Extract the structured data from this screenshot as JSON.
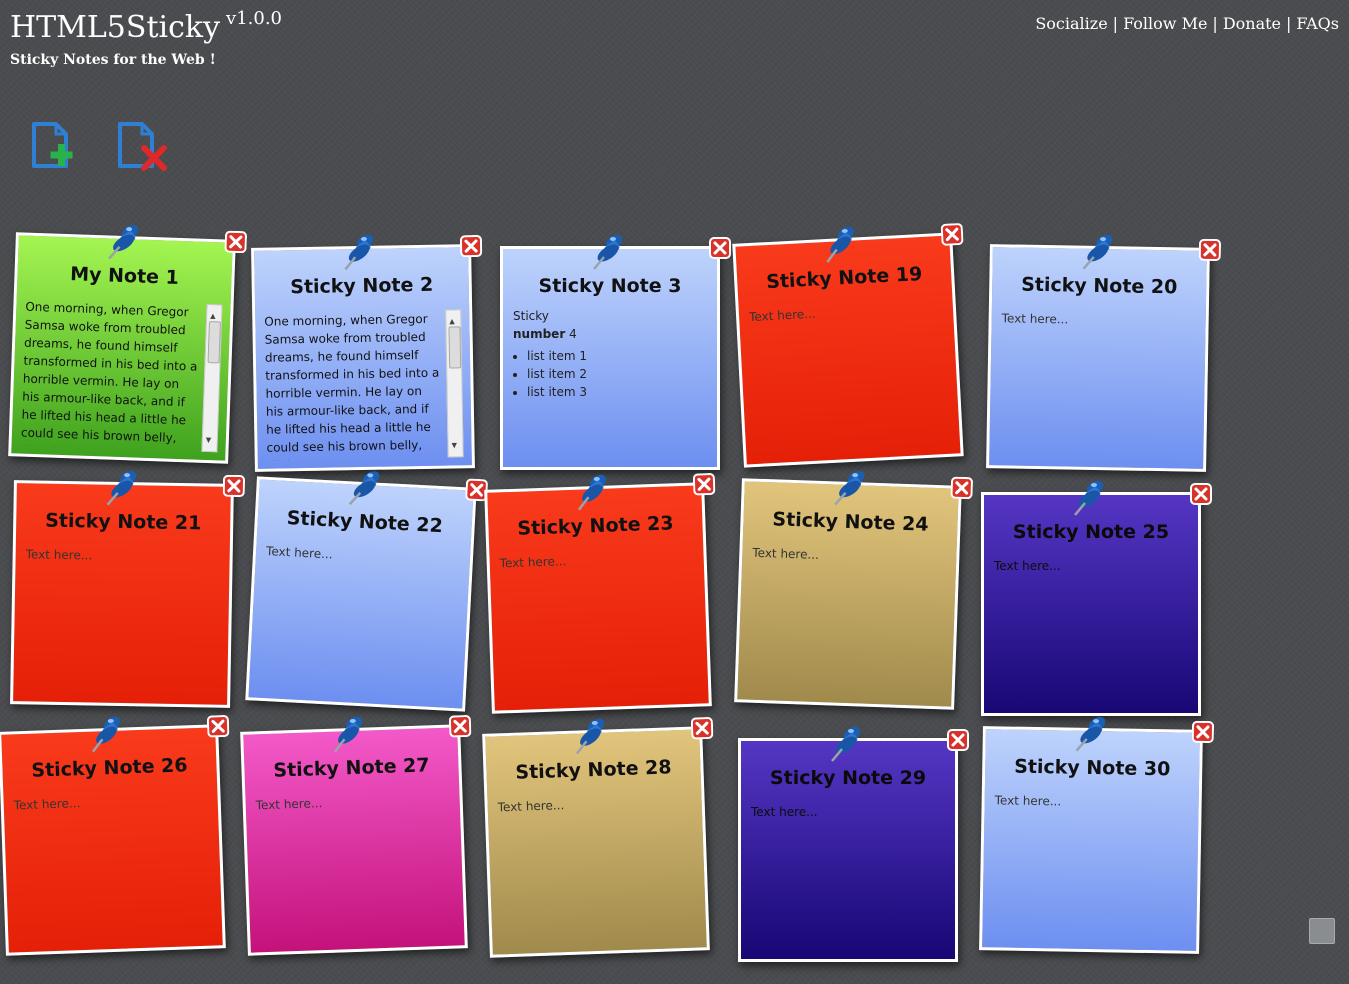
{
  "header": {
    "title": "HTML5Sticky",
    "version": "v1.0.0",
    "tagline": "Sticky Notes for the Web !"
  },
  "nav": {
    "items": [
      "Socialize",
      "Follow Me",
      "Donate",
      "FAQs"
    ],
    "separator": "|"
  },
  "toolbar": {
    "add_icon": "add-note-icon",
    "delete_icon": "delete-all-icon"
  },
  "notes": [
    {
      "title": "My Note 1",
      "color": "green",
      "text": "One morning, when Gregor Samsa woke from troubled dreams, he found himself transformed in his bed into a horrible vermin. He lay on his armour-like back, and if he lifted his head a little he could see his brown belly, slightly"
    },
    {
      "title": "Sticky Note 2",
      "color": "blue",
      "text": "One morning, when Gregor Samsa woke from troubled dreams, he found himself transformed in his bed into a horrible vermin. He lay on his armour-like back, and if he lifted his head a little he could see his brown belly, slightly"
    },
    {
      "title": "Sticky Note 3",
      "color": "blue",
      "line1": "Sticky",
      "bold": "number",
      "num": "4",
      "list": [
        "list item 1",
        "list item 2",
        "list item 3"
      ]
    },
    {
      "title": "Sticky Note 19",
      "color": "red",
      "placeholder": "Text here..."
    },
    {
      "title": "Sticky Note 20",
      "color": "blue",
      "placeholder": "Text here..."
    },
    {
      "title": "Sticky Note 21",
      "color": "red",
      "placeholder": "Text here..."
    },
    {
      "title": "Sticky Note 22",
      "color": "blue",
      "placeholder": "Text here..."
    },
    {
      "title": "Sticky Note 23",
      "color": "red",
      "placeholder": "Text here..."
    },
    {
      "title": "Sticky Note 24",
      "color": "tan",
      "placeholder": "Text here..."
    },
    {
      "title": "Sticky Note 25",
      "color": "purple",
      "placeholder": "Text here..."
    },
    {
      "title": "Sticky Note 26",
      "color": "red",
      "placeholder": "Text here..."
    },
    {
      "title": "Sticky Note 27",
      "color": "pink",
      "placeholder": "Text here..."
    },
    {
      "title": "Sticky Note 28",
      "color": "tan",
      "placeholder": "Text here..."
    },
    {
      "title": "Sticky Note 29",
      "color": "purple",
      "placeholder": "Text here..."
    },
    {
      "title": "Sticky Note 30",
      "color": "blue",
      "placeholder": "Text here..."
    }
  ]
}
